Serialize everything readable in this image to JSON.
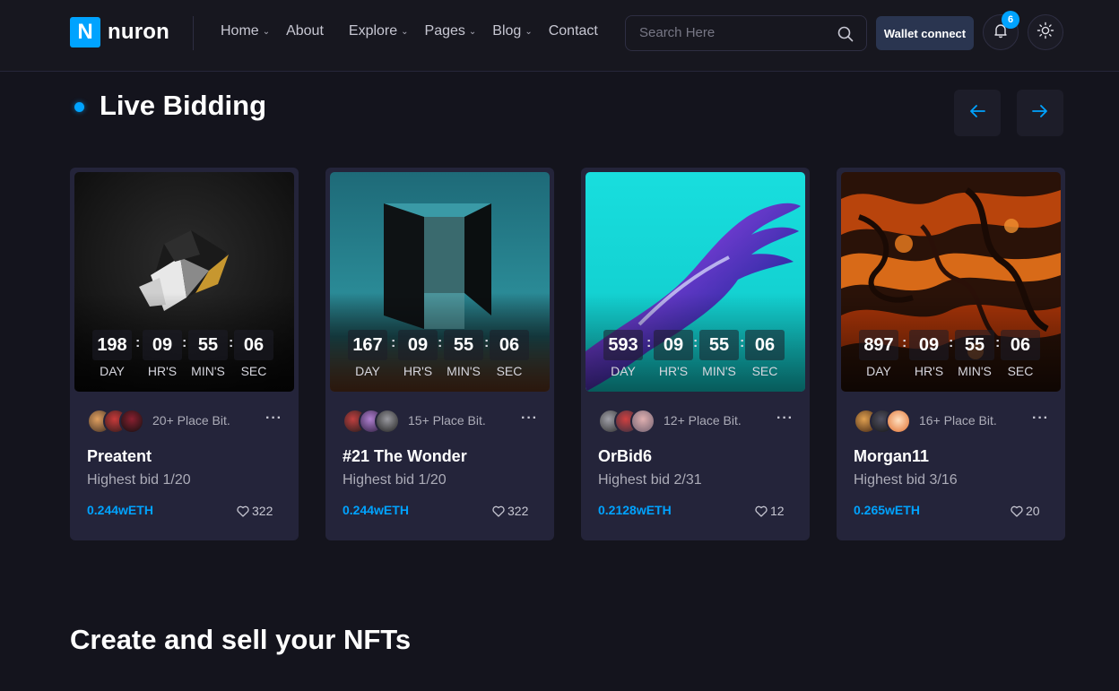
{
  "brand": {
    "mark": "N",
    "name": "nuron"
  },
  "nav": [
    {
      "label": "Home",
      "dropdown": true
    },
    {
      "label": "About",
      "dropdown": false
    },
    {
      "label": "Explore",
      "dropdown": true
    },
    {
      "label": "Pages",
      "dropdown": true
    },
    {
      "label": "Blog",
      "dropdown": true
    },
    {
      "label": "Contact",
      "dropdown": false
    }
  ],
  "search": {
    "placeholder": "Search Here"
  },
  "header": {
    "wallet_label": "Wallet connect",
    "notification_count": "6"
  },
  "section": {
    "title": "Live Bidding"
  },
  "countdown_labels": {
    "day": "DAY",
    "hr": "HR'S",
    "min": "MIN'S",
    "sec": "SEC"
  },
  "cards": [
    {
      "days": "198",
      "hours": "09",
      "mins": "55",
      "secs": "06",
      "place": "20+ Place Bit.",
      "title": "Preatent",
      "bid": "Highest bid 1/20",
      "price": "0.244wETH",
      "likes": "322"
    },
    {
      "days": "167",
      "hours": "09",
      "mins": "55",
      "secs": "06",
      "place": "15+ Place Bit.",
      "title": "#21 The Wonder",
      "bid": "Highest bid 1/20",
      "price": "0.244wETH",
      "likes": "322"
    },
    {
      "days": "593",
      "hours": "09",
      "mins": "55",
      "secs": "06",
      "place": "12+ Place Bit.",
      "title": "OrBid6",
      "bid": "Highest bid 2/31",
      "price": "0.2128wETH",
      "likes": "12"
    },
    {
      "days": "897",
      "hours": "09",
      "mins": "55",
      "secs": "06",
      "place": "16+ Place Bit.",
      "title": "Morgan11",
      "bid": "Highest bid 3/16",
      "price": "0.265wETH",
      "likes": "20"
    }
  ],
  "create": {
    "title": "Create and sell your NFTs"
  },
  "colors": {
    "accent": "#00a3ff",
    "background": "#14141d",
    "card": "#24243a",
    "wallet": "#2a3550"
  }
}
